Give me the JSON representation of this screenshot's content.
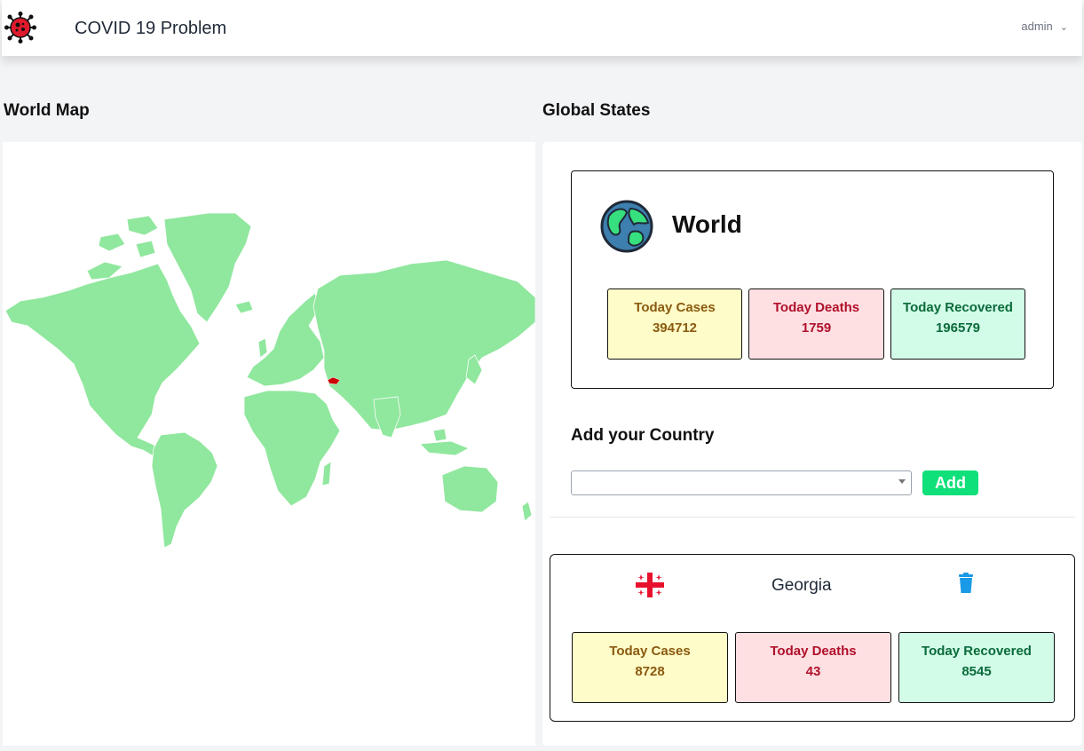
{
  "header": {
    "title": "COVID 19 Problem",
    "user": "admin"
  },
  "sections": {
    "map_title": "World Map",
    "stats_title": "Global States"
  },
  "world": {
    "name": "World",
    "stats": {
      "cases_label": "Today Cases",
      "cases": "394712",
      "deaths_label": "Today Deaths",
      "deaths": "1759",
      "recovered_label": "Today Recovered",
      "recovered": "196579"
    }
  },
  "add_country": {
    "title": "Add your Country",
    "select_value": "",
    "button": "Add"
  },
  "country": {
    "name": "Georgia",
    "stats": {
      "cases_label": "Today Cases",
      "cases": "8728",
      "deaths_label": "Today Deaths",
      "deaths": "43",
      "recovered_label": "Today Recovered",
      "recovered": "8545"
    }
  },
  "colors": {
    "land": "#90e79e",
    "highlight": "#cc0000",
    "cases_bg": "#fefcc8",
    "deaths_bg": "#fee0e3",
    "recovered_bg": "#d2fbe8",
    "add_button": "#10e07a",
    "trash_icon": "#1a9ae6"
  }
}
